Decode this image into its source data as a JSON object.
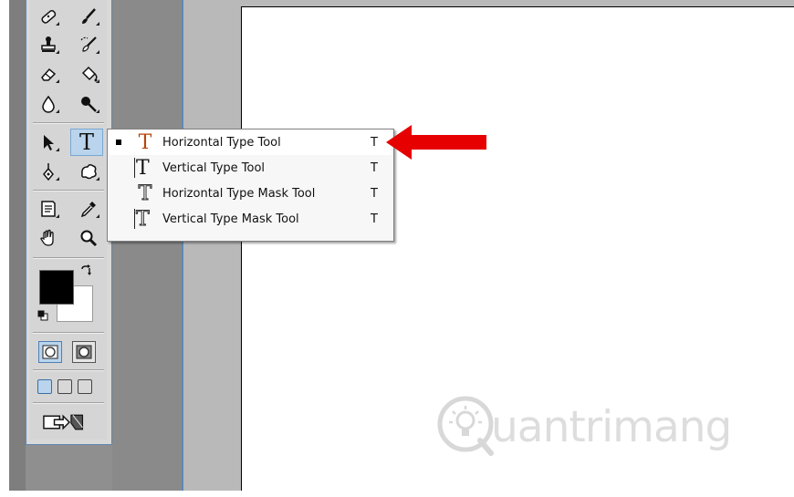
{
  "toolbox": {
    "tools": [
      {
        "id": "healing",
        "icon": "bandage-icon"
      },
      {
        "id": "brush",
        "icon": "brush-icon"
      },
      {
        "id": "clone-stamp",
        "icon": "stamp-icon"
      },
      {
        "id": "history-brush",
        "icon": "history-brush-icon"
      },
      {
        "id": "eraser",
        "icon": "eraser-icon"
      },
      {
        "id": "paint-bucket",
        "icon": "paint-bucket-icon"
      },
      {
        "id": "blur",
        "icon": "drop-icon"
      },
      {
        "id": "dodge",
        "icon": "dodge-icon"
      },
      {
        "id": "path-selection",
        "icon": "arrow-cursor-icon"
      },
      {
        "id": "type",
        "icon": "type-t-icon",
        "glyph": "T",
        "active": true
      },
      {
        "id": "pen",
        "icon": "pen-icon"
      },
      {
        "id": "shape",
        "icon": "custom-shape-icon"
      },
      {
        "id": "notes",
        "icon": "notes-icon"
      },
      {
        "id": "eyedropper",
        "icon": "eyedropper-icon"
      },
      {
        "id": "hand",
        "icon": "hand-icon"
      },
      {
        "id": "zoom",
        "icon": "zoom-icon"
      }
    ],
    "foreground_color": "#000000",
    "background_color": "#ffffff"
  },
  "flyout": {
    "items": [
      {
        "label": "Horizontal Type Tool",
        "shortcut": "T",
        "current": true,
        "icon": "horizontal-type-icon",
        "glyph": "T"
      },
      {
        "label": "Vertical Type Tool",
        "shortcut": "T",
        "current": false,
        "icon": "vertical-type-icon",
        "glyph": "T"
      },
      {
        "label": "Horizontal Type Mask Tool",
        "shortcut": "T",
        "current": false,
        "icon": "horizontal-type-mask-icon",
        "glyph": "T"
      },
      {
        "label": "Vertical Type Mask Tool",
        "shortcut": "T",
        "current": false,
        "icon": "vertical-type-mask-icon",
        "glyph": "T"
      }
    ]
  },
  "annotation": {
    "color": "#e60000",
    "icon": "red-arrow-icon"
  },
  "watermark": {
    "text": "uantrimang",
    "icon": "quantrimang-logo-icon"
  },
  "colors": {
    "accent": "#5d88b8",
    "selection": "#b9d4ec",
    "canvas": "#ffffff"
  }
}
